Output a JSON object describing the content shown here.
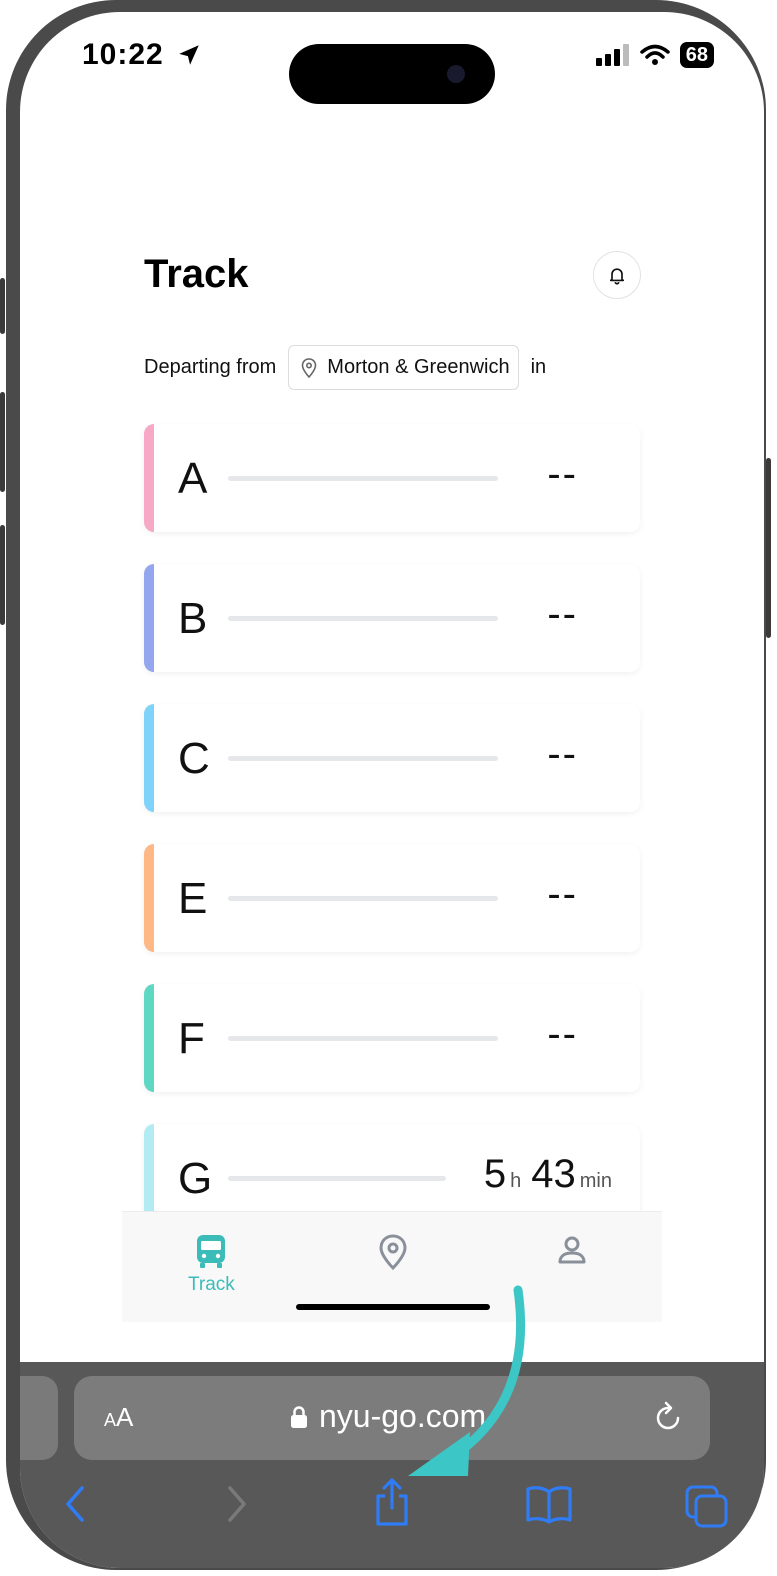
{
  "status_bar": {
    "time": "10:22",
    "battery": "68",
    "icons": [
      "location-arrow-icon",
      "cellular-signal-icon",
      "wifi-icon",
      "battery-icon"
    ]
  },
  "header": {
    "title": "Track",
    "bell_icon": "bell-icon"
  },
  "departing": {
    "prefix": "Departing from",
    "stop": "Morton & Greenwich",
    "suffix": "in",
    "stop_icon": "map-pin-icon"
  },
  "routes": [
    {
      "letter": "A",
      "eta": "--",
      "color": "#F7A8C4"
    },
    {
      "letter": "B",
      "eta": "--",
      "color": "#94A6EE"
    },
    {
      "letter": "C",
      "eta": "--",
      "color": "#7FD3FA"
    },
    {
      "letter": "E",
      "eta": "--",
      "color": "#FDB886"
    },
    {
      "letter": "F",
      "eta": "--",
      "color": "#5ED8C3"
    },
    {
      "letter": "G",
      "eta_hours": "5",
      "eta_hours_unit": "h",
      "eta_minutes": "43",
      "eta_minutes_unit": "min",
      "color": "#B2EBF2"
    }
  ],
  "tab_bar": {
    "tabs": [
      {
        "label": "Track",
        "icon": "bus-icon",
        "active": true
      },
      {
        "label": "",
        "icon": "map-pin-icon",
        "active": false
      },
      {
        "label": "",
        "icon": "user-icon",
        "active": false
      }
    ],
    "active_color": "#3BBCB8"
  },
  "safari": {
    "text_size_label": "AA",
    "url": "nyu-go.com",
    "toolbar_icons": [
      "back-icon",
      "forward-icon",
      "share-icon",
      "bookmarks-icon",
      "tabs-icon"
    ],
    "accent": "#2F7CF6"
  },
  "annotation": {
    "arrow_color": "#3CC6C6"
  }
}
